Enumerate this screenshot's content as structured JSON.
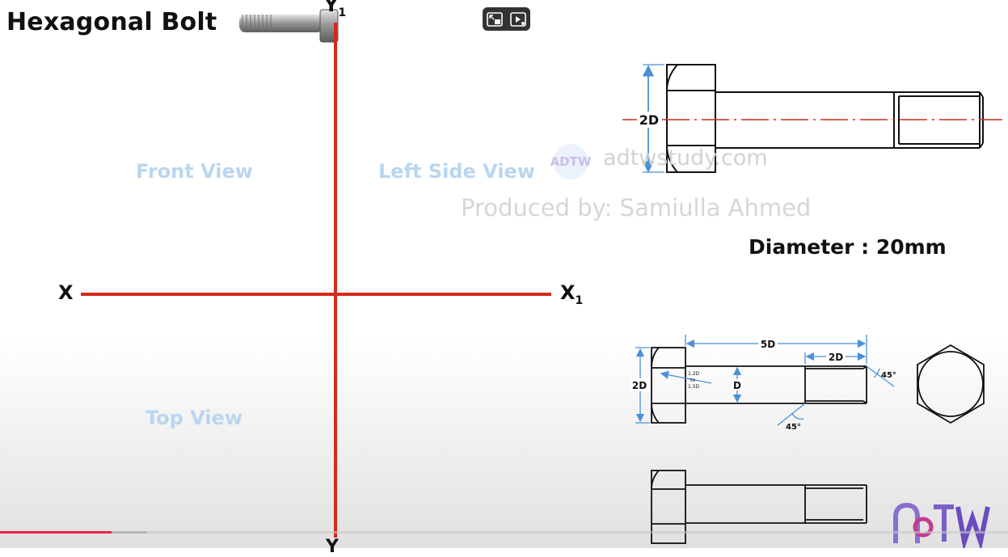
{
  "header": {
    "title": "Hexagonal Bolt"
  },
  "views": {
    "front": "Front View",
    "left_side": "Left Side View",
    "top": "Top View"
  },
  "axes": {
    "x": "X",
    "x1_main": "X",
    "x1_sub": "1",
    "y1_main": "Y",
    "y1_sub": "1",
    "y": "Y"
  },
  "watermark": {
    "logo_text": "ADTW",
    "site": "adtwstudy.com",
    "producer": "Produced by: Samiulla Ahmed"
  },
  "spec": {
    "diameter": "Diameter : 20mm"
  },
  "dimensions": {
    "top_height": "2D",
    "mid_height": "2D",
    "length": "5D",
    "thread_length": "2D",
    "shank_diameter": "D",
    "head_note_1": "1.2D",
    "head_note_2": "to",
    "head_note_3": "1.5D",
    "chamfer_angle_1": "45°",
    "chamfer_angle_2": "45°"
  },
  "player": {
    "progress_played": 0.111,
    "progress_loaded": 0.146
  },
  "colors": {
    "axis_red": "#d42a1a",
    "dim_blue": "#4a90d9",
    "view_label": "#b9d6f0",
    "progress_red": "#f0224e"
  }
}
